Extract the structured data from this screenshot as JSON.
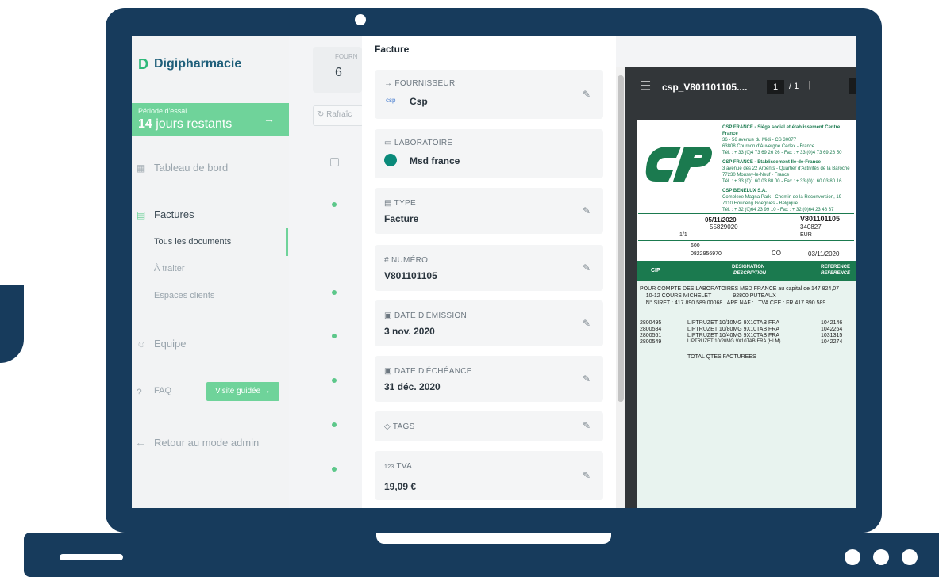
{
  "sidebar": {
    "logo_mark": "D",
    "app_name": "Digipharmacie",
    "trial_label": "Période d'essai",
    "trial_days": "14",
    "trial_rest": "jours restants",
    "trial_arrow": "→",
    "items": [
      {
        "label": "Tableau de bord",
        "icon": "dashboard-icon"
      },
      {
        "label": "Factures",
        "icon": "invoice-icon"
      },
      {
        "label": "Equipe",
        "icon": "team-icon"
      },
      {
        "label": "FAQ",
        "icon": "help-icon"
      },
      {
        "label": "Retour au mode admin",
        "icon": "arrow-left-icon"
      }
    ],
    "subitems": [
      "Tous les documents",
      "À traiter",
      "Espaces clients"
    ],
    "guide_button": "Visite guidée →"
  },
  "list": {
    "fourn_label": "FOURN",
    "fourn_value": "6",
    "refresh_label": "Rafraîc"
  },
  "detail": {
    "title": "Facture",
    "fields": [
      {
        "label": "FOURNISSEUR",
        "value": "Csp",
        "icon": "arrow-right-icon"
      },
      {
        "label": "LABORATOIRE",
        "value": "Msd france",
        "icon": "lab-icon"
      },
      {
        "label": "TYPE",
        "value": "Facture",
        "icon": "document-icon"
      },
      {
        "label": "NUMÉRO",
        "value": "V801101105",
        "icon": "hash-icon"
      },
      {
        "label": "DATE D'ÉMISSION",
        "value": "3 nov. 2020",
        "icon": "calendar-icon"
      },
      {
        "label": "DATE D'ÉCHÉANCE",
        "value": "31 déc. 2020",
        "icon": "calendar-icon"
      },
      {
        "label": "TAGS",
        "value": "",
        "icon": "tag-icon"
      },
      {
        "label": "TVA",
        "value": "19,09 €",
        "icon": "number-icon"
      }
    ]
  },
  "pdf": {
    "filename": "csp_V801101105....",
    "page": "1",
    "total": "/ 1",
    "sep": "|",
    "minus": "—",
    "header_lines": [
      "CSP FRANCE - Siège social et établissement Centre France",
      "36 - 56 avenue du Midi - CS 30077",
      "63808 Cournon d'Auvergne Cedex - France",
      "Tél. : + 33 (0)4 73 69 26 26 - Fax : + 33 (0)4 73 69 26 50",
      "CSP FRANCE - Etablissement Ile-de-France",
      "3 avenue des 22 Arpents - Quartier d'Activités de la Baroche",
      "77230 Moussy-le-Neuf - France",
      "Tél. : + 33 (0)1 60 03 80 00 - Fax : + 33 (0)1 60 03 80 16",
      "CSP BENELUX S.A.",
      "Complexe Magna Park - Chemin de la Reconversion, 19",
      "7110 Houdeng Goegnies - Belgique",
      "Tél. : + 32 (0)64 23 99 10 - Fax : + 32 (0)64 23 48 37"
    ],
    "date": "05/11/2020",
    "client_no": "55829020",
    "invoice_no": "V801101105",
    "order_no": "340827",
    "currency": "EUR",
    "page_ratio": "1/1",
    "rep_no": "600",
    "siret": "0822956970",
    "co": "CO",
    "co_date": "03/11/2020",
    "col_cip": "CIP",
    "col_designation": "DESIGNATION",
    "col_description": "DESCRIPTION",
    "col_reference": "REFERENCE",
    "col_reference2": "REFERENCE",
    "body_lines": [
      "POUR COMPTE DES LABORATOIRES   MSD FRANCE    au capital de 147 824,07",
      "    10-12 COURS MICHELET              92800 PUTEAUX",
      "    N° SIRET : 417 890 589 00068   APE NAF :   TVA CEE : FR 417 890 589"
    ],
    "rows": [
      {
        "cip": "2800495",
        "desc": "LIPTRUZET 10/10MG 9X10TAB FRA",
        "ref": "1042146"
      },
      {
        "cip": "2800584",
        "desc": "LIPTRUZET 10/80MG 9X10TAB FRA",
        "ref": "1042264"
      },
      {
        "cip": "2800561",
        "desc": "LIPTRUZET 10/40MG 9X10TAB FRA",
        "ref": "1031315"
      },
      {
        "cip": "2800549",
        "desc": "LIPTRUZET 10/20MG 9X10TAB FRA (HLM)",
        "ref": "1042274"
      }
    ],
    "total_line": "TOTAL QTES FACTUREES"
  },
  "colors": {
    "frame": "#173b5c",
    "accent": "#6fd39a",
    "csp_green": "#1b7a4f"
  }
}
